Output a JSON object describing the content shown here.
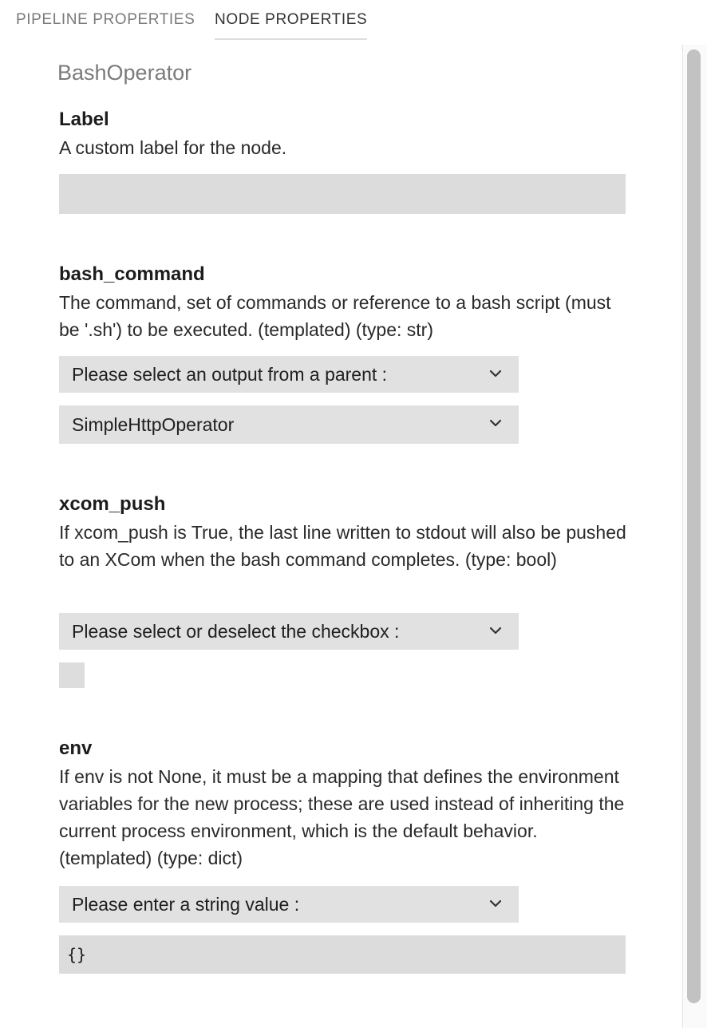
{
  "tabs": {
    "pipeline": "PIPELINE PROPERTIES",
    "node": "NODE PROPERTIES"
  },
  "node_title": "BashOperator",
  "fields": {
    "label": {
      "name": "Label",
      "description": "A custom label for the node.",
      "value": ""
    },
    "bash_command": {
      "name": "bash_command",
      "description": "The command, set of commands or reference to a bash script (must be '.sh') to be executed. (templated) (type: str)",
      "source_select": "Please select an output from a parent :",
      "parent_select": "SimpleHttpOperator"
    },
    "xcom_push": {
      "name": "xcom_push",
      "description": "If xcom_push is True, the last line written to stdout will also be pushed to an XCom when the bash command completes. (type: bool)",
      "source_select": "Please select or deselect the checkbox :",
      "checked": false
    },
    "env": {
      "name": "env",
      "description": "If env is not None, it must be a mapping that defines the environment variables for the new process; these are used instead of inheriting the current process environment, which is the default behavior. (templated) (type: dict)",
      "source_select": "Please enter a string value :",
      "value": "{}"
    }
  },
  "colors": {
    "input_bg": "#dcdcdc",
    "select_bg": "#e1e1e1",
    "scroll_thumb": "#c2c2c2"
  },
  "icons": {
    "select_arrow": "chevron-down-icon"
  }
}
